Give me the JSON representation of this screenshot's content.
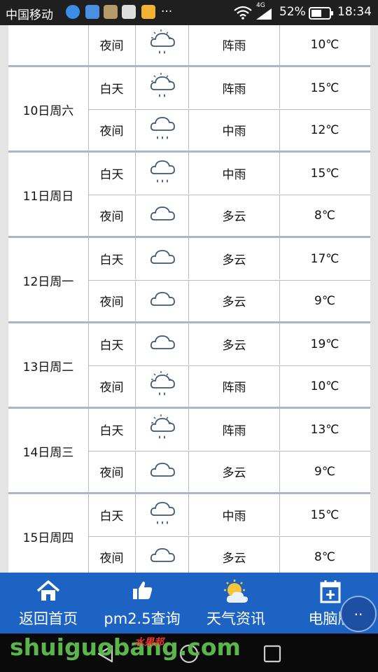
{
  "status_bar": {
    "carrier": "中国移动",
    "more": "···",
    "network": "4G",
    "battery": "52%",
    "time": "18:34"
  },
  "forecast": {
    "partial_top": {
      "period": "夜间",
      "icon": "cloud-sun-rain-icon",
      "condition": "阵雨",
      "temp": "10℃"
    },
    "days": [
      {
        "date": "10日周六",
        "periods": [
          {
            "period": "白天",
            "icon": "cloud-sun-rain-icon",
            "condition": "阵雨",
            "temp": "15℃"
          },
          {
            "period": "夜间",
            "icon": "cloud-rain-icon",
            "condition": "中雨",
            "temp": "12℃"
          }
        ]
      },
      {
        "date": "11日周日",
        "periods": [
          {
            "period": "白天",
            "icon": "cloud-rain-icon",
            "condition": "中雨",
            "temp": "15℃"
          },
          {
            "period": "夜间",
            "icon": "cloud-icon",
            "condition": "多云",
            "temp": "8℃"
          }
        ]
      },
      {
        "date": "12日周一",
        "periods": [
          {
            "period": "白天",
            "icon": "cloud-icon",
            "condition": "多云",
            "temp": "17℃"
          },
          {
            "period": "夜间",
            "icon": "cloud-icon",
            "condition": "多云",
            "temp": "9℃"
          }
        ]
      },
      {
        "date": "13日周二",
        "periods": [
          {
            "period": "白天",
            "icon": "cloud-icon",
            "condition": "多云",
            "temp": "19℃"
          },
          {
            "period": "夜间",
            "icon": "cloud-sun-rain-icon",
            "condition": "阵雨",
            "temp": "10℃"
          }
        ]
      },
      {
        "date": "14日周三",
        "periods": [
          {
            "period": "白天",
            "icon": "cloud-sun-rain-icon",
            "condition": "阵雨",
            "temp": "13℃"
          },
          {
            "period": "夜间",
            "icon": "cloud-icon",
            "condition": "多云",
            "temp": "9℃"
          }
        ]
      },
      {
        "date": "15日周四",
        "periods": [
          {
            "period": "白天",
            "icon": "cloud-rain-icon",
            "condition": "中雨",
            "temp": "15℃"
          },
          {
            "period": "夜间",
            "icon": "cloud-icon",
            "condition": "多云",
            "temp": "8℃"
          }
        ]
      }
    ]
  },
  "bottom_nav": {
    "items": [
      {
        "label": "返回首页",
        "icon": "home-icon"
      },
      {
        "label": "pm2.5查询",
        "icon": "thumbs-up-icon"
      },
      {
        "label": "天气资讯",
        "icon": "sun-cloud-icon"
      },
      {
        "label": "电脑版",
        "icon": "calendar-plus-icon"
      }
    ],
    "more_label": "··"
  },
  "watermark": {
    "text": "shuiguobang.com",
    "cn_text": "水果邦"
  },
  "colors": {
    "nav_bg": "#1d63c4",
    "status_bg": "#1f1f1f",
    "grid_line": "#b7bec7",
    "icon_stroke": "#3f5a74"
  }
}
